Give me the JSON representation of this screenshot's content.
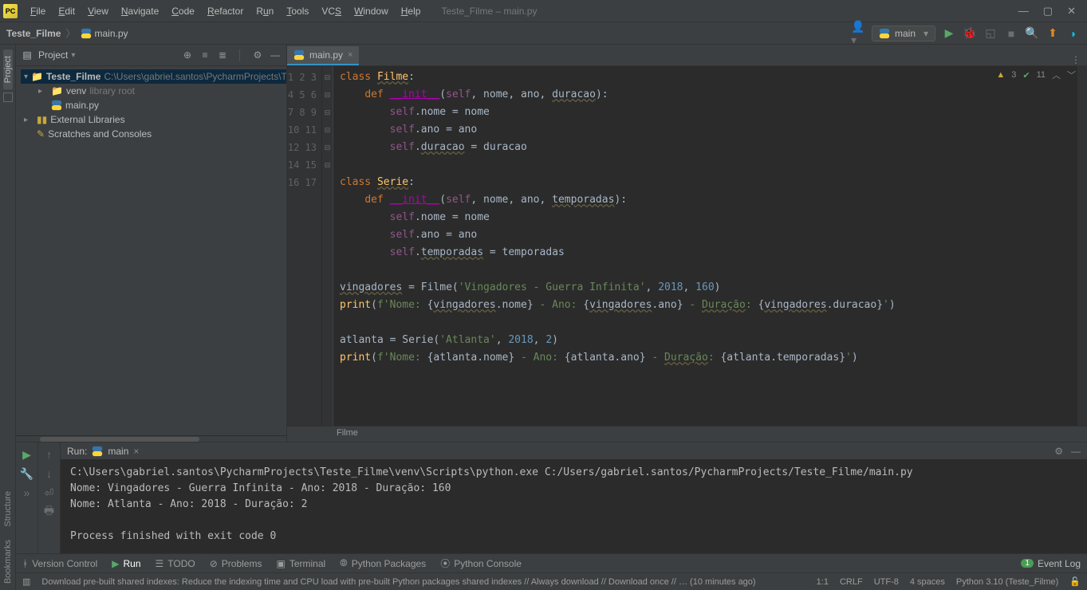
{
  "window": {
    "title": "Teste_Filme – main.py"
  },
  "menu": [
    "File",
    "Edit",
    "View",
    "Navigate",
    "Code",
    "Refactor",
    "Run",
    "Tools",
    "VCS",
    "Window",
    "Help"
  ],
  "breadcrumb": {
    "project": "Teste_Filme",
    "file": "main.py"
  },
  "runConfig": {
    "name": "main"
  },
  "icons": {
    "logo": "PC"
  },
  "projectPanel": {
    "title": "Project",
    "root": {
      "name": "Teste_Filme",
      "path": "C:\\Users\\gabriel.santos\\PycharmProjects\\T"
    },
    "venv": {
      "name": "venv",
      "tag": "library root"
    },
    "file": "main.py",
    "ext": "External Libraries",
    "scratch": "Scratches and Consoles"
  },
  "editor": {
    "tab": "main.py",
    "lines": [
      "1",
      "2",
      "3",
      "4",
      "5",
      "6",
      "7",
      "8",
      "9",
      "10",
      "11",
      "12",
      "13",
      "14",
      "15",
      "16",
      "17"
    ],
    "inspections": {
      "warnings": "3",
      "checks": "11"
    },
    "crumb": "Filme"
  },
  "run": {
    "label": "Run:",
    "config": "main",
    "output": [
      "C:\\Users\\gabriel.santos\\PycharmProjects\\Teste_Filme\\venv\\Scripts\\python.exe C:/Users/gabriel.santos/PycharmProjects/Teste_Filme/main.py",
      "Nome: Vingadores - Guerra Infinita - Ano: 2018 - Duração: 160",
      "Nome: Atlanta - Ano: 2018 - Duração: 2",
      "",
      "Process finished with exit code 0"
    ]
  },
  "bottomTools": {
    "vcs": "Version Control",
    "run": "Run",
    "todo": "TODO",
    "problems": "Problems",
    "terminal": "Terminal",
    "pypackages": "Python Packages",
    "pyconsole": "Python Console",
    "eventlog": "Event Log",
    "eventcount": "1"
  },
  "statusbar": {
    "msg": "Download pre-built shared indexes: Reduce the indexing time and CPU load with pre-built Python packages shared indexes // Always download // Download once // … (10 minutes ago)",
    "pos": "1:1",
    "eol": "CRLF",
    "enc": "UTF-8",
    "indent": "4 spaces",
    "interpreter": "Python 3.10 (Teste_Filme)"
  }
}
